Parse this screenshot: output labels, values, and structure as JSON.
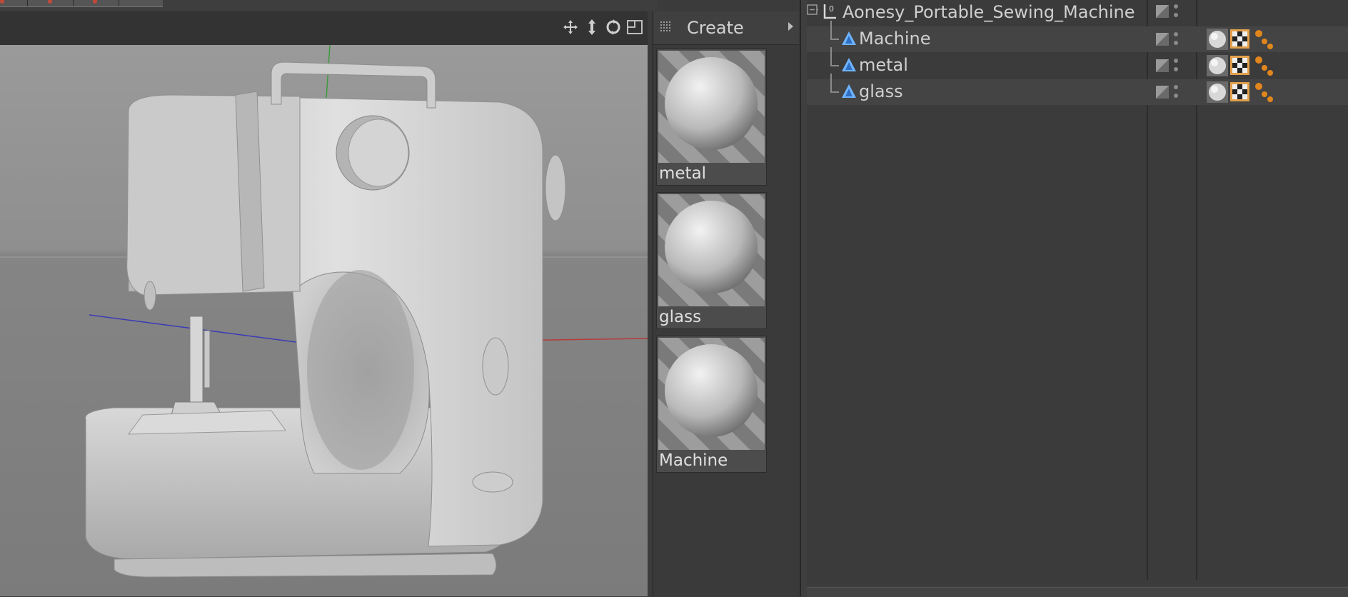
{
  "material_manager": {
    "create_label": "Create",
    "materials": [
      {
        "name": "metal"
      },
      {
        "name": "glass"
      },
      {
        "name": "Machine"
      }
    ]
  },
  "object_manager": {
    "root": {
      "name": "Aonesy_Portable_Sewing_Machine",
      "icon": "null-object-icon"
    },
    "children": [
      {
        "name": "Machine",
        "icon": "polygon-object-icon",
        "tags": [
          "material-tag-icon",
          "texture-tag-icon",
          "phong-tag-icon"
        ]
      },
      {
        "name": "metal",
        "icon": "polygon-object-icon",
        "tags": [
          "material-tag-icon",
          "texture-tag-icon",
          "phong-tag-icon"
        ]
      },
      {
        "name": "glass",
        "icon": "polygon-object-icon",
        "tags": [
          "material-tag-icon",
          "texture-tag-icon",
          "phong-tag-icon"
        ]
      }
    ]
  },
  "viewport": {
    "nav_icons": [
      "move-view-icon",
      "zoom-view-icon",
      "rotate-view-icon",
      "toggle-view-icon"
    ],
    "axis_colors": {
      "x": "#c03030",
      "y": "#30a030",
      "z": "#3030c0"
    }
  }
}
